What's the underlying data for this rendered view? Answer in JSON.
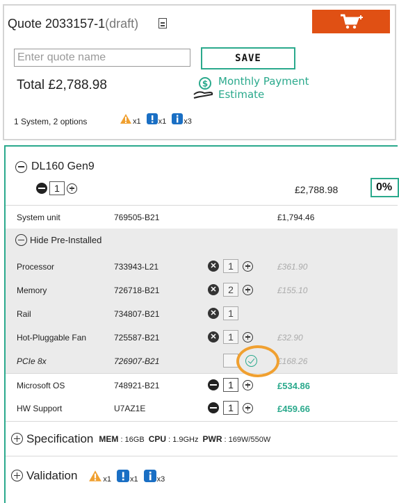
{
  "quote": {
    "title": "Quote 2033157-1",
    "status": "(draft)",
    "name_placeholder": "Enter quote name",
    "name_value": "",
    "save_label": "SAVE",
    "total": "Total £2,788.98",
    "monthly_line1": "Monthly Payment",
    "monthly_line2": "Estimate",
    "summary": "1 System, 2 options",
    "badges": [
      {
        "type": "warning-icon",
        "count": "x1",
        "color": "#f0a030"
      },
      {
        "type": "exclamation-icon",
        "count": "x1",
        "color": "#1a6fc4"
      },
      {
        "type": "info-icon",
        "count": "x3",
        "color": "#1a6fc4"
      }
    ],
    "cart_color": "#e05014"
  },
  "system": {
    "name": "DL160 Gen9",
    "qty": "1",
    "price": "£2,788.98",
    "discount": "0%",
    "unit": {
      "name": "System unit",
      "pn": "769505-B21",
      "price": "£1,794.46"
    },
    "toggle_label": "Hide Pre-Installed",
    "preinstalled": [
      {
        "name": "Processor",
        "pn": "733943-L21",
        "qty": "1",
        "price": "£361.90"
      },
      {
        "name": "Memory",
        "pn": "726718-B21",
        "qty": "2",
        "price": "£155.10"
      },
      {
        "name": "Rail",
        "pn": "734807-B21",
        "qty": "1",
        "price": ""
      },
      {
        "name": "Hot-Pluggable Fan",
        "pn": "725587-B21",
        "qty": "1",
        "price": "£32.90"
      },
      {
        "name": "PCIe 8x",
        "pn": "726907-B21",
        "qty": "",
        "price": "£168.26"
      }
    ],
    "options": [
      {
        "name": "Microsoft OS",
        "pn": "748921-B21",
        "qty": "1",
        "price": "£534.86"
      },
      {
        "name": "HW Support",
        "pn": "U7AZ1E",
        "qty": "1",
        "price": "£459.66"
      }
    ],
    "spec_label": "Specification",
    "spec": {
      "mem_label": "MEM",
      "mem": " : 16GB",
      "cpu_label": "CPU",
      "cpu": " : 1.9GHz",
      "pwr_label": "PWR",
      "pwr": " : 169W/550W"
    },
    "validation_label": "Validation",
    "accent": "#2aa98c"
  }
}
